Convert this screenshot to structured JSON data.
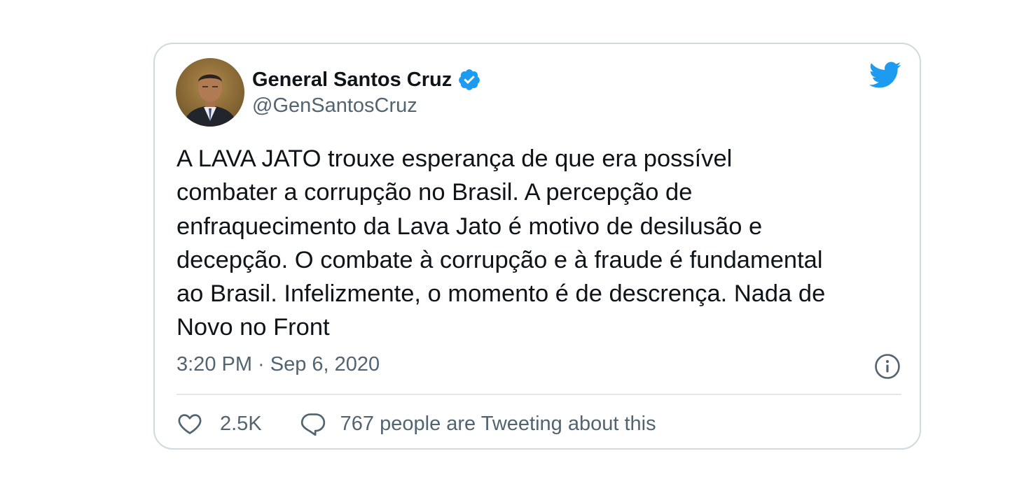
{
  "author": {
    "display_name": "General Santos Cruz",
    "handle": "@GenSantosCruz",
    "verified": true,
    "avatar": "avatar"
  },
  "tweet": {
    "lines": [
      "A LAVA JATO trouxe esperança de que era possível",
      "combater a corrupção no Brasil. A percepção de",
      "enfraquecimento da Lava Jato é motivo de desilusão e",
      "decepção. O combate à corrupção e à fraude é fundamental",
      "ao Brasil. Infelizmente, o momento é de descrença. Nada de",
      "Novo no Front"
    ],
    "timestamp": "3:20 PM · Sep 6, 2020"
  },
  "actions": {
    "likes": "2.5K",
    "tweeting": "767 people are Tweeting about this"
  },
  "icons": {
    "brand": "twitter-bird-icon",
    "verified": "verified-badge-icon",
    "info": "info-icon",
    "like": "heart-icon",
    "reply": "reply-bubble-icon"
  },
  "colors": {
    "brand_blue": "#1d9bf0",
    "text_primary": "#0f1419",
    "text_secondary": "#536471",
    "border": "#cfd9de"
  }
}
